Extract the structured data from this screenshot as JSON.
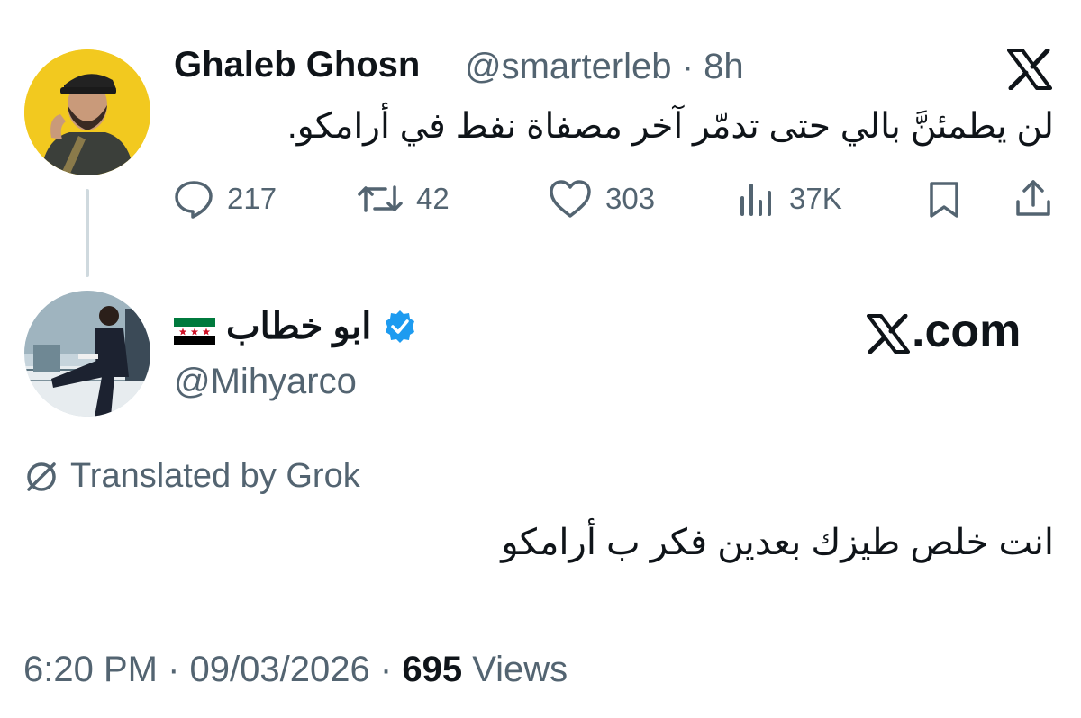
{
  "original_tweet": {
    "author_name": "Ghaleb Ghosn",
    "handle": "@smarterleb",
    "separator": "·",
    "time_ago": "8h",
    "text": "لن يطمئنَّ بالي حتى تدمّر آخر مصفاة نفط في أرامكو.",
    "stats": {
      "replies": "217",
      "reposts": "42",
      "likes": "303",
      "views": "37K"
    },
    "platform_icon": "x-logo-icon",
    "avatar_icon": "avatar-photo"
  },
  "reply_tweet": {
    "author_name": "ابو خطاب",
    "flag_icon": "syria-flag-icon",
    "verified_icon": "verified-badge-icon",
    "handle": "@Mihyarco",
    "site": ".com",
    "translated_label": "Translated by Grok",
    "text": "انت خلص طيزك بعدين فكر ب أرامكو",
    "time": "6:20 PM",
    "separator": "·",
    "date": "09/03/2026",
    "views_count": "695",
    "views_label": "Views"
  },
  "colors": {
    "text_primary": "#0f1419",
    "text_secondary": "#536471",
    "verified_blue": "#1d9bf0",
    "thread_line": "#cfd9de",
    "avatar1_bg": "#f2c91f"
  }
}
